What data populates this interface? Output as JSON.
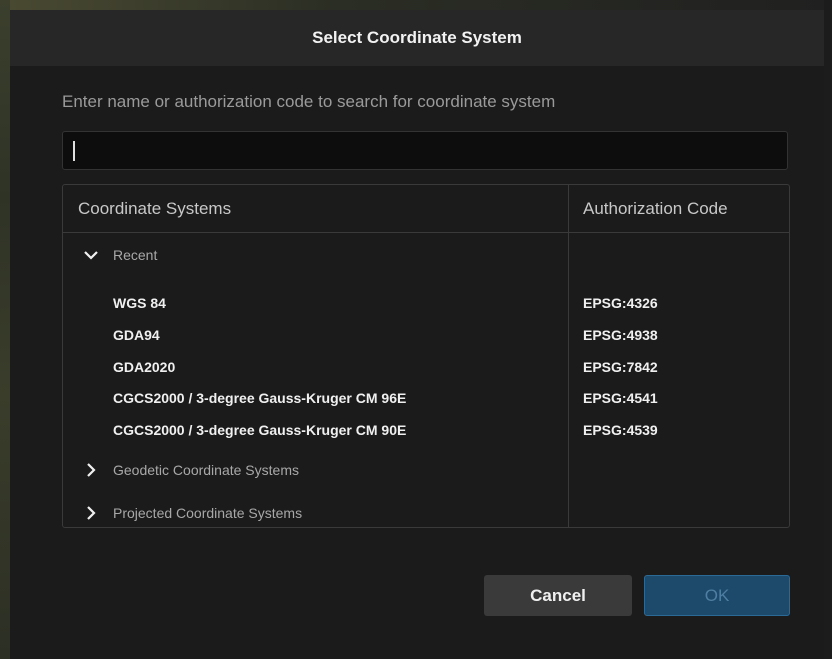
{
  "dialog": {
    "title": "Select Coordinate System",
    "prompt": "Enter name or authorization code to search for coordinate system",
    "search_value": ""
  },
  "table": {
    "headers": {
      "name": "Coordinate Systems",
      "code": "Authorization Code"
    },
    "groups": {
      "recent": {
        "label": "Recent",
        "expanded": true,
        "icon": "chevron-down-icon"
      },
      "geodetic": {
        "label": "Geodetic Coordinate Systems",
        "expanded": false,
        "icon": "chevron-right-icon"
      },
      "projected": {
        "label": "Projected Coordinate Systems",
        "expanded": false,
        "icon": "chevron-right-icon"
      }
    },
    "recent_items": [
      {
        "name": "WGS 84",
        "code": "EPSG:4326"
      },
      {
        "name": "GDA94",
        "code": "EPSG:4938"
      },
      {
        "name": "GDA2020",
        "code": "EPSG:7842"
      },
      {
        "name": "CGCS2000 / 3-degree Gauss-Kruger CM 96E",
        "code": "EPSG:4541"
      },
      {
        "name": "CGCS2000 / 3-degree Gauss-Kruger CM 90E",
        "code": "EPSG:4539"
      }
    ]
  },
  "buttons": {
    "cancel": "Cancel",
    "ok": "OK"
  },
  "colors": {
    "dialog_bg": "#1b1b1b",
    "titlebar_bg": "#272727",
    "ok_bg": "#1d4a6b",
    "cancel_bg": "#3a3a3a"
  }
}
